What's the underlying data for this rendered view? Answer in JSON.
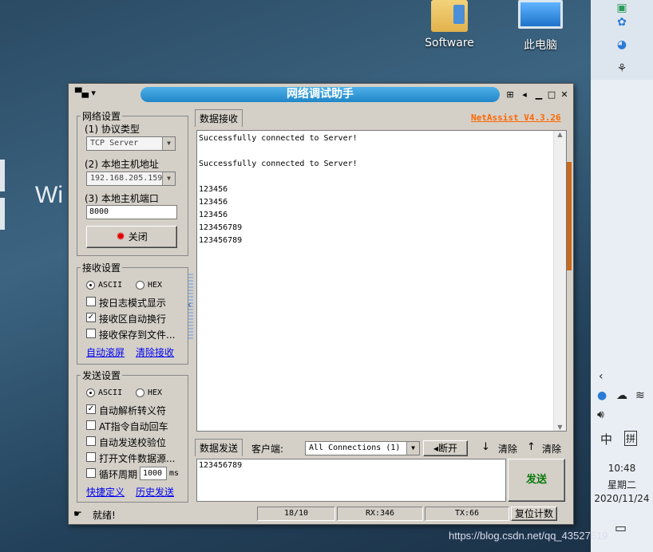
{
  "desktop": {
    "icons": [
      {
        "label": "Software"
      },
      {
        "label": "此电脑"
      }
    ],
    "partial_text": "Wi",
    "watermark": "https://blog.csdn.net/qq_43527619"
  },
  "tray": {
    "time": "10:48",
    "weekday": "星期二",
    "date": "2020/11/24",
    "ime": "中",
    "ime_mode": "拼"
  },
  "window": {
    "title": "网络调试助手",
    "version": "NetAssist V4.3.26",
    "network": {
      "group_label": "网络设置",
      "protocol_label": "(1) 协议类型",
      "protocol_value": "TCP Server",
      "host_label": "(2) 本地主机地址",
      "host_value": "192.168.205.159",
      "port_label": "(3) 本地主机端口",
      "port_value": "8000",
      "close_button": "关闭"
    },
    "receive_settings": {
      "group_label": "接收设置",
      "ascii": "ASCII",
      "hex": "HEX",
      "opt_log": "按日志模式显示",
      "opt_wrap": "接收区自动换行",
      "opt_save": "接收保存到文件...",
      "auto_scroll": "自动滚屏",
      "clear_recv": "清除接收"
    },
    "send_settings": {
      "group_label": "发送设置",
      "ascii": "ASCII",
      "hex": "HEX",
      "opt_escape": "自动解析转义符",
      "opt_at": "AT指令自动回车",
      "opt_checksum": "自动发送校验位",
      "opt_file": "打开文件数据源...",
      "opt_cycle": "循环周期",
      "cycle_value": "1000",
      "cycle_unit": "ms",
      "shortcut": "快捷定义",
      "history": "历史发送"
    },
    "recv_tab": "数据接收",
    "recv_lines": [
      "Successfully connected to Server!",
      "",
      "Successfully connected to Server!",
      "",
      "123456",
      "123456",
      "123456",
      "123456789",
      "123456789"
    ],
    "send_tab": "数据发送",
    "client_label": "客户端:",
    "client_value": "All Connections (1)",
    "disconnect": "断开",
    "clear1": "清除",
    "clear2": "清除",
    "send_text": "123456789",
    "send_button": "发送",
    "status": {
      "ready": "就绪!",
      "count": "18/10",
      "rx": "RX:346",
      "tx": "TX:66",
      "reset": "复位计数"
    }
  },
  "colors": {
    "title_pill": "#1f86c8",
    "version": "#ff6600",
    "send_button_text": "#0a7a0a",
    "close_icon": "#e00000"
  }
}
